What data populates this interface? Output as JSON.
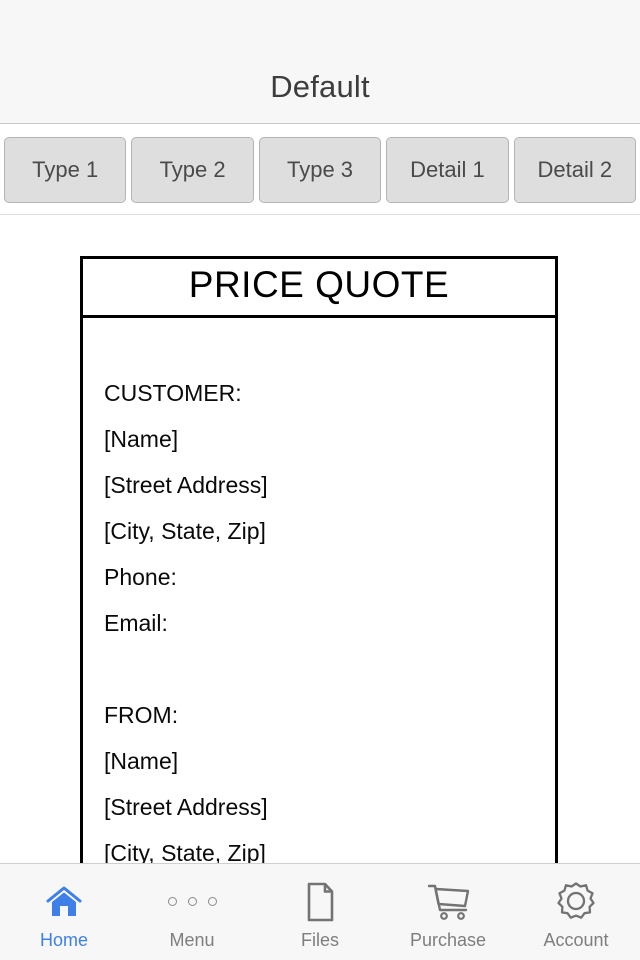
{
  "header": {
    "title": "Default"
  },
  "segmented_tabs": [
    {
      "label": "Type 1"
    },
    {
      "label": "Type 2"
    },
    {
      "label": "Type 3"
    },
    {
      "label": "Detail 1"
    },
    {
      "label": "Detail 2"
    }
  ],
  "document": {
    "title": "PRICE QUOTE",
    "lines": [
      "CUSTOMER:",
      "[Name]",
      "[Street Address]",
      "[City, State, Zip]",
      "Phone:",
      "Email:",
      "",
      "FROM:",
      "[Name]",
      "[Street Address]",
      "[City, State, Zip]"
    ]
  },
  "tabbar": {
    "items": [
      {
        "label": "Home",
        "icon": "home-icon",
        "active": true
      },
      {
        "label": "Menu",
        "icon": "dots-icon",
        "active": false
      },
      {
        "label": "Files",
        "icon": "document-icon",
        "active": false
      },
      {
        "label": "Purchase",
        "icon": "cart-icon",
        "active": false
      },
      {
        "label": "Account",
        "icon": "gear-icon",
        "active": false
      }
    ]
  },
  "colors": {
    "accent": "#3E7FE8",
    "inactive": "#7E7E7E",
    "header_bg": "#F7F7F7",
    "segment_bg": "#DEDEDE"
  }
}
